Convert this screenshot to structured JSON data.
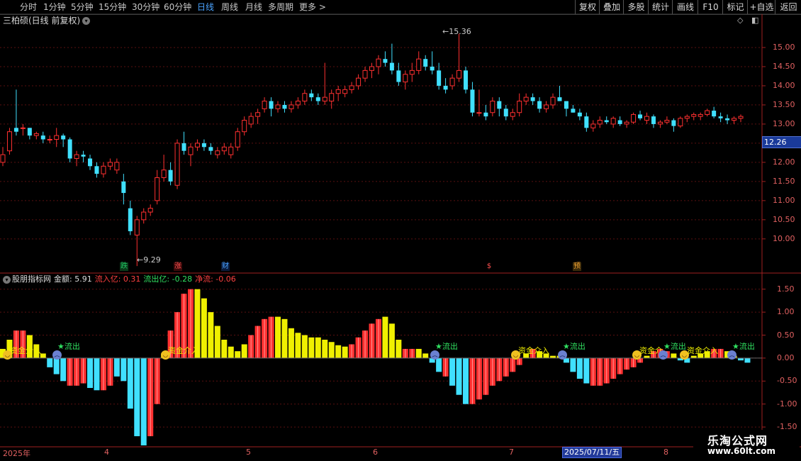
{
  "toolbar": {
    "periods": [
      "分时",
      "1分钟",
      "5分钟",
      "15分钟",
      "30分钟",
      "60分钟",
      "日线",
      "周线",
      "月线",
      "多周期",
      "更多 >"
    ],
    "active_period": "日线",
    "actions": [
      "复权",
      "叠加",
      "多股",
      "统计",
      "画线",
      "F10",
      "标记",
      "+自选",
      "返回"
    ]
  },
  "stock": {
    "title": "三柏硕(日线 前复权)",
    "current_price": "12.26",
    "high_label": "15.36",
    "low_label": "9.29"
  },
  "main_axis": {
    "ticks": [
      "15.00",
      "14.50",
      "14.00",
      "13.50",
      "13.00",
      "12.50",
      "12.00",
      "11.50",
      "11.00",
      "10.50",
      "10.00"
    ]
  },
  "event_markers": [
    {
      "text": "跌",
      "color": "#20c060",
      "bg": "#0a3a1a"
    },
    {
      "text": "涨",
      "color": "#ff5050",
      "bg": "#3a0a0a"
    },
    {
      "text": "财",
      "color": "#4aa3ff",
      "bg": "#0a1a3a"
    },
    {
      "text": "$",
      "color": "#ff5050",
      "bg": "#000000"
    },
    {
      "text": "预",
      "color": "#f0a030",
      "bg": "#3a2a0a"
    }
  ],
  "indicator": {
    "name": "股朋指标网",
    "amount_label": "金额: 5.91",
    "inflow_label": "流入亿: 0.31",
    "outflow_label": "流出亿: -0.28",
    "net_label": "净流: -0.06",
    "ticks": [
      "1.50",
      "1.00",
      "0.50",
      "0.00",
      "-0.50",
      "-1.00",
      "-1.50"
    ]
  },
  "signals": {
    "in_text": "资金介入",
    "out_text": "★流出",
    "in_text_short": "资金介",
    "out_text_short": "★流出"
  },
  "x_axis": {
    "labels": [
      "2025年",
      "4",
      "5",
      "6",
      "7",
      "8"
    ],
    "selected_date": "2025/07/11/五"
  },
  "watermark": {
    "line1": "乐淘公式网",
    "line2": "www.60lt.com"
  },
  "colors": {
    "up": "#ff3030",
    "down": "#40e0ff",
    "yellow": "#f0f000",
    "axis": "#a02020",
    "grid": "#5a1010"
  },
  "chart_data": [
    {
      "type": "candlestick",
      "title": "三柏硕(日线 前复权)",
      "ylim": [
        9.2,
        15.5
      ],
      "high": 15.36,
      "low": 9.29,
      "ohlc": [
        [
          12.0,
          12.4,
          11.9,
          12.2
        ],
        [
          12.3,
          12.9,
          12.2,
          12.8
        ],
        [
          12.9,
          13.9,
          12.7,
          12.8
        ],
        [
          12.9,
          13.0,
          12.7,
          12.9
        ],
        [
          12.9,
          12.9,
          12.6,
          12.7
        ],
        [
          12.7,
          12.8,
          12.6,
          12.75
        ],
        [
          12.7,
          12.8,
          12.5,
          12.6
        ],
        [
          12.6,
          12.7,
          12.5,
          12.6
        ],
        [
          12.6,
          12.9,
          12.4,
          12.7
        ],
        [
          12.7,
          12.75,
          12.4,
          12.6
        ],
        [
          12.6,
          12.65,
          12.0,
          12.1
        ],
        [
          12.1,
          12.3,
          11.9,
          12.2
        ],
        [
          12.2,
          12.3,
          12.0,
          12.15
        ],
        [
          12.1,
          12.2,
          11.8,
          11.9
        ],
        [
          11.9,
          12.0,
          11.6,
          11.7
        ],
        [
          11.7,
          12.0,
          11.6,
          11.9
        ],
        [
          11.9,
          12.1,
          11.8,
          12.0
        ],
        [
          11.8,
          12.1,
          11.7,
          12.0
        ],
        [
          11.5,
          11.7,
          10.9,
          11.2
        ],
        [
          10.8,
          11.0,
          10.1,
          10.2
        ],
        [
          10.1,
          10.6,
          9.29,
          10.5
        ],
        [
          10.5,
          10.8,
          10.4,
          10.7
        ],
        [
          10.7,
          10.9,
          10.6,
          10.8
        ],
        [
          11.0,
          11.8,
          10.9,
          11.6
        ],
        [
          11.6,
          12.2,
          11.5,
          11.8
        ],
        [
          11.8,
          12.0,
          11.4,
          11.5
        ],
        [
          11.4,
          12.6,
          11.3,
          12.5
        ],
        [
          12.5,
          12.8,
          12.2,
          12.3
        ],
        [
          12.2,
          12.5,
          11.9,
          12.4
        ],
        [
          12.4,
          12.6,
          12.3,
          12.5
        ],
        [
          12.5,
          12.6,
          12.3,
          12.4
        ],
        [
          12.4,
          12.5,
          12.2,
          12.3
        ],
        [
          12.2,
          12.4,
          12.1,
          12.3
        ],
        [
          12.3,
          12.5,
          12.2,
          12.4
        ],
        [
          12.2,
          12.5,
          12.1,
          12.4
        ],
        [
          12.4,
          12.9,
          12.3,
          12.8
        ],
        [
          12.8,
          13.2,
          12.7,
          13.1
        ],
        [
          13.0,
          13.3,
          12.9,
          13.2
        ],
        [
          13.2,
          13.4,
          13.0,
          13.3
        ],
        [
          13.4,
          13.7,
          13.3,
          13.6
        ],
        [
          13.6,
          13.7,
          13.2,
          13.4
        ],
        [
          13.4,
          13.6,
          13.3,
          13.5
        ],
        [
          13.5,
          13.6,
          13.3,
          13.4
        ],
        [
          13.4,
          13.6,
          13.3,
          13.5
        ],
        [
          13.5,
          13.7,
          13.4,
          13.6
        ],
        [
          13.6,
          13.9,
          13.5,
          13.8
        ],
        [
          13.8,
          13.9,
          13.6,
          13.7
        ],
        [
          13.7,
          13.8,
          13.5,
          13.6
        ],
        [
          13.6,
          14.6,
          13.5,
          13.7
        ],
        [
          13.6,
          13.9,
          13.4,
          13.8
        ],
        [
          13.8,
          14.0,
          13.6,
          13.9
        ],
        [
          13.8,
          14.0,
          13.7,
          13.9
        ],
        [
          13.9,
          14.1,
          13.8,
          14.0
        ],
        [
          14.0,
          14.3,
          13.9,
          14.2
        ],
        [
          14.2,
          14.5,
          14.1,
          14.4
        ],
        [
          14.4,
          14.6,
          14.2,
          14.5
        ],
        [
          14.5,
          14.8,
          14.3,
          14.7
        ],
        [
          14.7,
          14.9,
          14.5,
          14.6
        ],
        [
          14.6,
          15.1,
          14.3,
          14.4
        ],
        [
          14.4,
          14.6,
          14.0,
          14.1
        ],
        [
          14.1,
          14.4,
          13.9,
          14.3
        ],
        [
          14.3,
          14.6,
          14.1,
          14.4
        ],
        [
          14.4,
          14.9,
          14.3,
          14.7
        ],
        [
          14.7,
          14.8,
          14.4,
          14.5
        ],
        [
          14.5,
          14.9,
          14.3,
          14.4
        ],
        [
          14.4,
          14.6,
          13.9,
          14.0
        ],
        [
          14.0,
          14.2,
          13.8,
          13.9
        ],
        [
          14.0,
          14.3,
          13.9,
          14.2
        ],
        [
          14.2,
          15.36,
          14.1,
          14.4
        ],
        [
          14.4,
          14.5,
          13.8,
          13.9
        ],
        [
          13.9,
          14.1,
          13.2,
          13.3
        ],
        [
          13.3,
          13.9,
          13.2,
          13.3
        ],
        [
          13.3,
          13.5,
          13.1,
          13.2
        ],
        [
          13.3,
          13.7,
          13.2,
          13.6
        ],
        [
          13.6,
          13.7,
          13.2,
          13.4
        ],
        [
          13.4,
          13.5,
          13.1,
          13.2
        ],
        [
          13.2,
          13.4,
          13.1,
          13.3
        ],
        [
          13.3,
          13.8,
          13.2,
          13.6
        ],
        [
          13.6,
          13.8,
          13.5,
          13.7
        ],
        [
          13.7,
          13.8,
          13.5,
          13.6
        ],
        [
          13.6,
          13.7,
          13.3,
          13.4
        ],
        [
          13.4,
          13.6,
          13.3,
          13.5
        ],
        [
          13.5,
          13.8,
          13.4,
          13.7
        ],
        [
          13.7,
          14.0,
          13.6,
          13.6
        ],
        [
          13.6,
          13.6,
          13.2,
          13.4
        ],
        [
          13.4,
          13.5,
          13.3,
          13.3
        ],
        [
          13.3,
          13.4,
          13.1,
          13.2
        ],
        [
          13.2,
          13.3,
          12.8,
          12.9
        ],
        [
          12.9,
          13.1,
          12.8,
          13.0
        ],
        [
          13.0,
          13.2,
          12.9,
          13.1
        ],
        [
          13.1,
          13.2,
          13.0,
          13.05
        ],
        [
          13.0,
          13.2,
          12.9,
          13.15
        ],
        [
          13.1,
          13.2,
          12.95,
          13.0
        ],
        [
          13.0,
          13.1,
          12.9,
          13.05
        ],
        [
          13.05,
          13.3,
          13.0,
          13.25
        ],
        [
          13.25,
          13.35,
          13.1,
          13.15
        ],
        [
          13.1,
          13.3,
          13.0,
          13.2
        ],
        [
          13.2,
          13.25,
          12.9,
          13.0
        ],
        [
          13.0,
          13.1,
          12.9,
          13.05
        ],
        [
          13.05,
          13.2,
          13.0,
          13.1
        ],
        [
          13.1,
          13.15,
          12.8,
          12.95
        ],
        [
          12.95,
          13.2,
          12.9,
          13.15
        ],
        [
          13.15,
          13.25,
          13.05,
          13.2
        ],
        [
          13.2,
          13.3,
          13.1,
          13.25
        ],
        [
          13.2,
          13.3,
          13.1,
          13.25
        ],
        [
          13.25,
          13.4,
          13.2,
          13.35
        ],
        [
          13.35,
          13.45,
          13.15,
          13.2
        ],
        [
          13.2,
          13.3,
          13.05,
          13.15
        ],
        [
          13.15,
          13.25,
          13.0,
          13.1
        ],
        [
          13.1,
          13.2,
          13.0,
          13.15
        ],
        [
          13.15,
          13.25,
          13.05,
          13.2
        ]
      ]
    },
    {
      "type": "bar",
      "title": "股朋指标网",
      "ylim": [
        -1.9,
        1.75
      ],
      "values": [
        0.2,
        0.4,
        0.6,
        0.6,
        0.5,
        0.3,
        0.1,
        -0.2,
        -0.35,
        -0.5,
        -0.6,
        -0.6,
        -0.55,
        -0.65,
        -0.7,
        -0.7,
        -0.6,
        -0.4,
        -0.5,
        -1.1,
        -1.7,
        -1.9,
        -1.7,
        -1.0,
        0.1,
        0.6,
        1.0,
        1.4,
        1.5,
        1.5,
        1.3,
        1.0,
        0.7,
        0.4,
        0.25,
        0.15,
        0.3,
        0.5,
        0.7,
        0.85,
        0.9,
        0.9,
        0.85,
        0.65,
        0.55,
        0.5,
        0.45,
        0.45,
        0.4,
        0.35,
        0.28,
        0.25,
        0.3,
        0.45,
        0.6,
        0.75,
        0.85,
        0.9,
        0.75,
        0.4,
        0.2,
        0.2,
        0.2,
        0.1,
        -0.1,
        -0.3,
        -0.4,
        -0.6,
        -0.8,
        -1.0,
        -1.0,
        -0.9,
        -0.8,
        -0.6,
        -0.5,
        -0.4,
        -0.3,
        -0.15,
        0.1,
        0.2,
        0.15,
        0.1,
        0.05,
        0.05,
        -0.1,
        -0.3,
        -0.45,
        -0.55,
        -0.6,
        -0.6,
        -0.55,
        -0.45,
        -0.35,
        -0.25,
        -0.2,
        -0.1,
        0.05,
        0.15,
        0.2,
        0.15,
        0.1,
        -0.05,
        -0.1,
        0.05,
        0.1,
        0.15,
        0.2,
        0.2,
        0.15,
        0.05,
        -0.05,
        -0.1
      ],
      "colors": [
        "y",
        "y",
        "r",
        "r",
        "y",
        "y",
        "y",
        "c",
        "c",
        "c",
        "r",
        "r",
        "r",
        "c",
        "c",
        "r",
        "r",
        "c",
        "c",
        "c",
        "c",
        "c",
        "r",
        "r",
        "y",
        "r",
        "r",
        "r",
        "r",
        "y",
        "y",
        "y",
        "y",
        "y",
        "y",
        "y",
        "y",
        "r",
        "r",
        "r",
        "r",
        "y",
        "y",
        "y",
        "y",
        "y",
        "y",
        "y",
        "y",
        "y",
        "y",
        "y",
        "r",
        "r",
        "r",
        "r",
        "r",
        "y",
        "y",
        "y",
        "r",
        "r",
        "y",
        "y",
        "c",
        "c",
        "r",
        "c",
        "c",
        "c",
        "r",
        "r",
        "r",
        "r",
        "r",
        "r",
        "r",
        "r",
        "y",
        "r",
        "y",
        "y",
        "y",
        "y",
        "c",
        "c",
        "c",
        "c",
        "r",
        "r",
        "r",
        "r",
        "r",
        "r",
        "r",
        "r",
        "y",
        "r",
        "r",
        "r",
        "y",
        "c",
        "c",
        "y",
        "y",
        "y",
        "r",
        "r",
        "y",
        "y",
        "c",
        "c"
      ]
    }
  ]
}
